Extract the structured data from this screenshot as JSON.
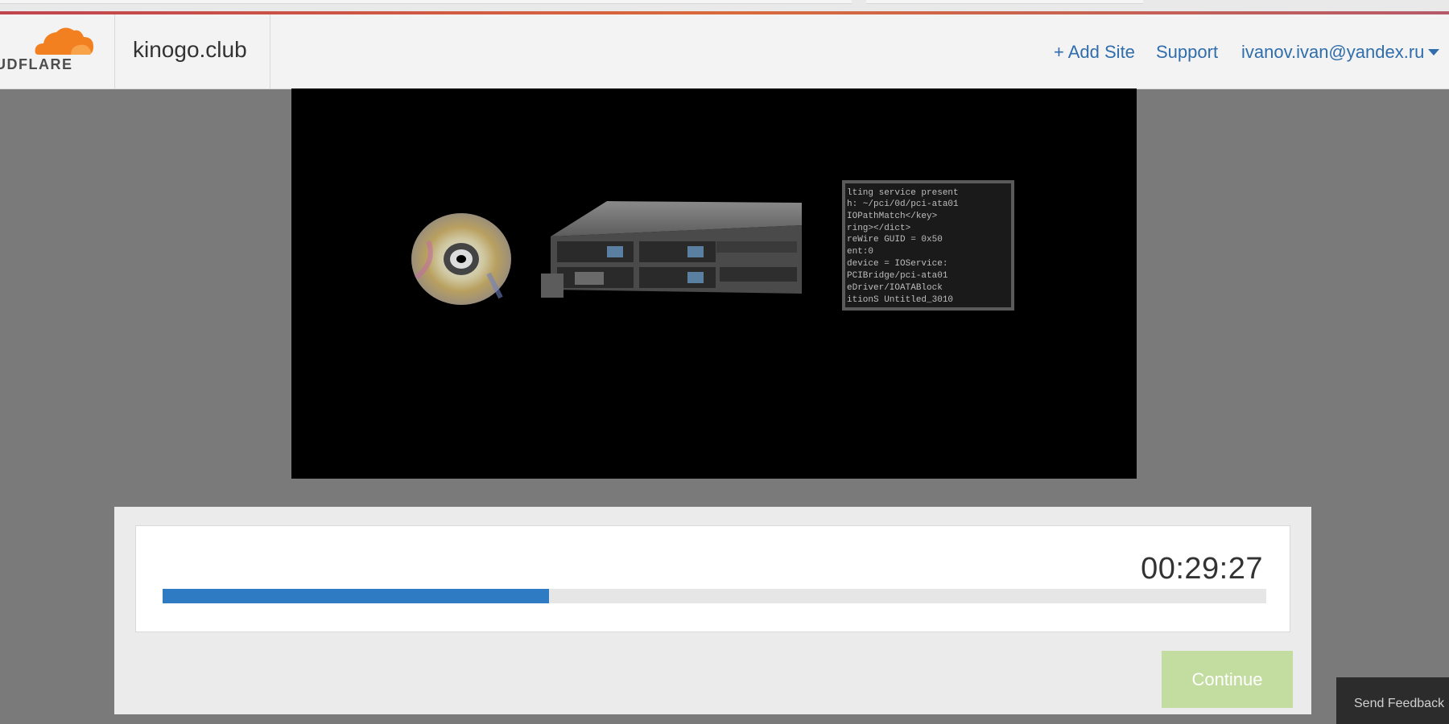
{
  "header": {
    "logo_text": "UDFLARE",
    "site_name": "kinogo.club",
    "nav": {
      "add_site": "+ Add Site",
      "support": "Support",
      "account": "ivanov.ivan@yandex.ru"
    }
  },
  "progress_dialog": {
    "timer": "00:29:27",
    "progress_fraction": 0.35,
    "continue_label": "Continue"
  },
  "feedback": {
    "label": "Send Feedback"
  },
  "colors": {
    "accent_strip": [
      "#c0444f",
      "#d96a3a",
      "#b65a6a"
    ],
    "brand_orange": "#f38020",
    "link_blue": "#2f6dab",
    "progress_blue": "#2e7bc4",
    "continue_disabled": "#c3dca0"
  },
  "icons": {
    "logo": "cloudflare-cloud-icon",
    "caret": "chevron-down-icon"
  }
}
